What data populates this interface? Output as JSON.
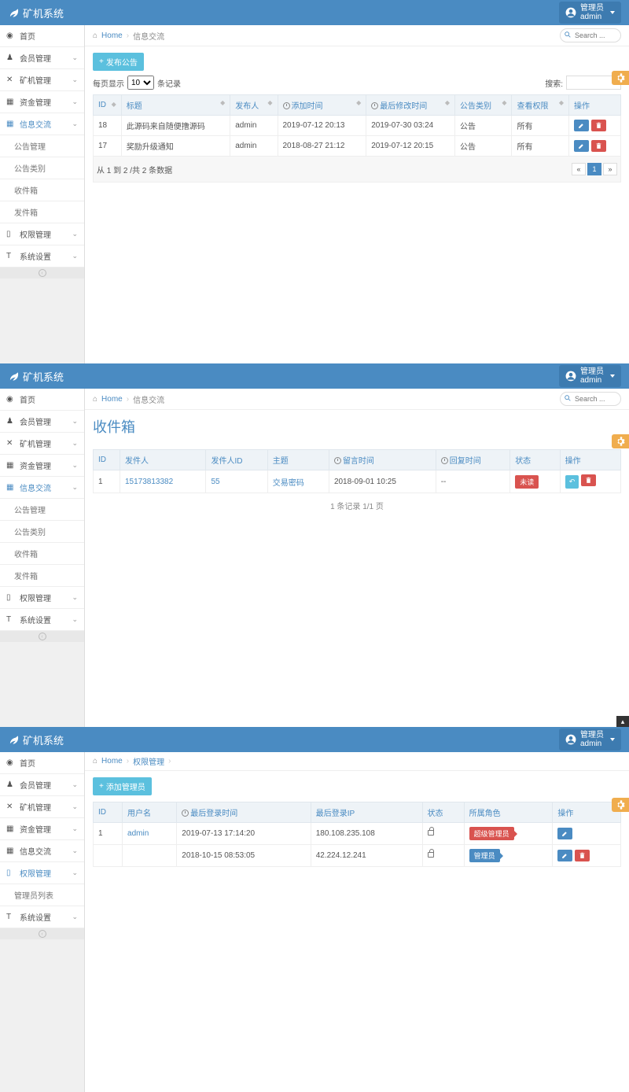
{
  "brand": "矿机系统",
  "user": {
    "role": "管理员",
    "name": "admin"
  },
  "search_placeholder": "Search ...",
  "nav": {
    "home": "首页",
    "member": "会员管理",
    "miner": "矿机管理",
    "fund": "资金管理",
    "info": "信息交流",
    "perm": "权限管理",
    "sys": "系统设置",
    "sub_info": {
      "ann_mgmt": "公告管理",
      "ann_type": "公告类别",
      "inbox": "收件箱",
      "outbox": "发件箱"
    },
    "sub_perm": {
      "admin_list": "管理员列表"
    }
  },
  "crumb": {
    "home": "Home",
    "info": "信息交流",
    "perm": "权限管理"
  },
  "panel1": {
    "btn_publish": "发布公告",
    "per_page_pre": "每页显示",
    "per_page_val": "10",
    "per_page_suf": "条记录",
    "search_label": "搜索:",
    "cols": {
      "id": "ID",
      "title": "标题",
      "author": "发布人",
      "add_time": "添加时间",
      "mod_time": "最后修改时间",
      "cat": "公告类别",
      "perm": "查看权限",
      "op": "操作"
    },
    "rows": [
      {
        "id": "18",
        "title": "此源码来自随便撸源码",
        "author": "admin",
        "add": "2019-07-12 20:13",
        "mod": "2019-07-30 03:24",
        "cat": "公告",
        "perm": "所有"
      },
      {
        "id": "17",
        "title": "奖励升级通知",
        "author": "admin",
        "add": "2018-08-27 21:12",
        "mod": "2019-07-12 20:15",
        "cat": "公告",
        "perm": "所有"
      }
    ],
    "summary": "从 1 到 2 /共 2 条数据",
    "pager": {
      "prev": "«",
      "page": "1",
      "next": "»"
    }
  },
  "panel2": {
    "title": "收件箱",
    "cols": {
      "id": "ID",
      "sender": "发件人",
      "sender_id": "发件人ID",
      "subject": "主题",
      "msg_time": "留言时间",
      "reply_time": "回复时间",
      "status": "状态",
      "op": "操作"
    },
    "rows": [
      {
        "id": "1",
        "sender": "15173813382",
        "sender_id": "55",
        "subject": "交易密码",
        "msg_time": "2018-09-01 10:25",
        "reply_time": "--",
        "status": "未读"
      }
    ],
    "footer": "1 条记录 1/1 页"
  },
  "panel3": {
    "btn_add": "添加管理员",
    "cols": {
      "id": "ID",
      "user": "用户名",
      "last_login": "最后登录时间",
      "last_ip": "最后登录IP",
      "status": "状态",
      "role": "所属角色",
      "op": "操作"
    },
    "rows": [
      {
        "id": "1",
        "user": "admin",
        "login": "2019-07-13 17:14:20",
        "ip": "180.108.235.108",
        "role": "超级管理员",
        "role_cls": "pink",
        "del": false
      },
      {
        "id": "",
        "user": "",
        "login": "2018-10-15 08:53:05",
        "ip": "42.224.12.241",
        "role": "管理员",
        "role_cls": "blue",
        "del": true
      }
    ]
  }
}
